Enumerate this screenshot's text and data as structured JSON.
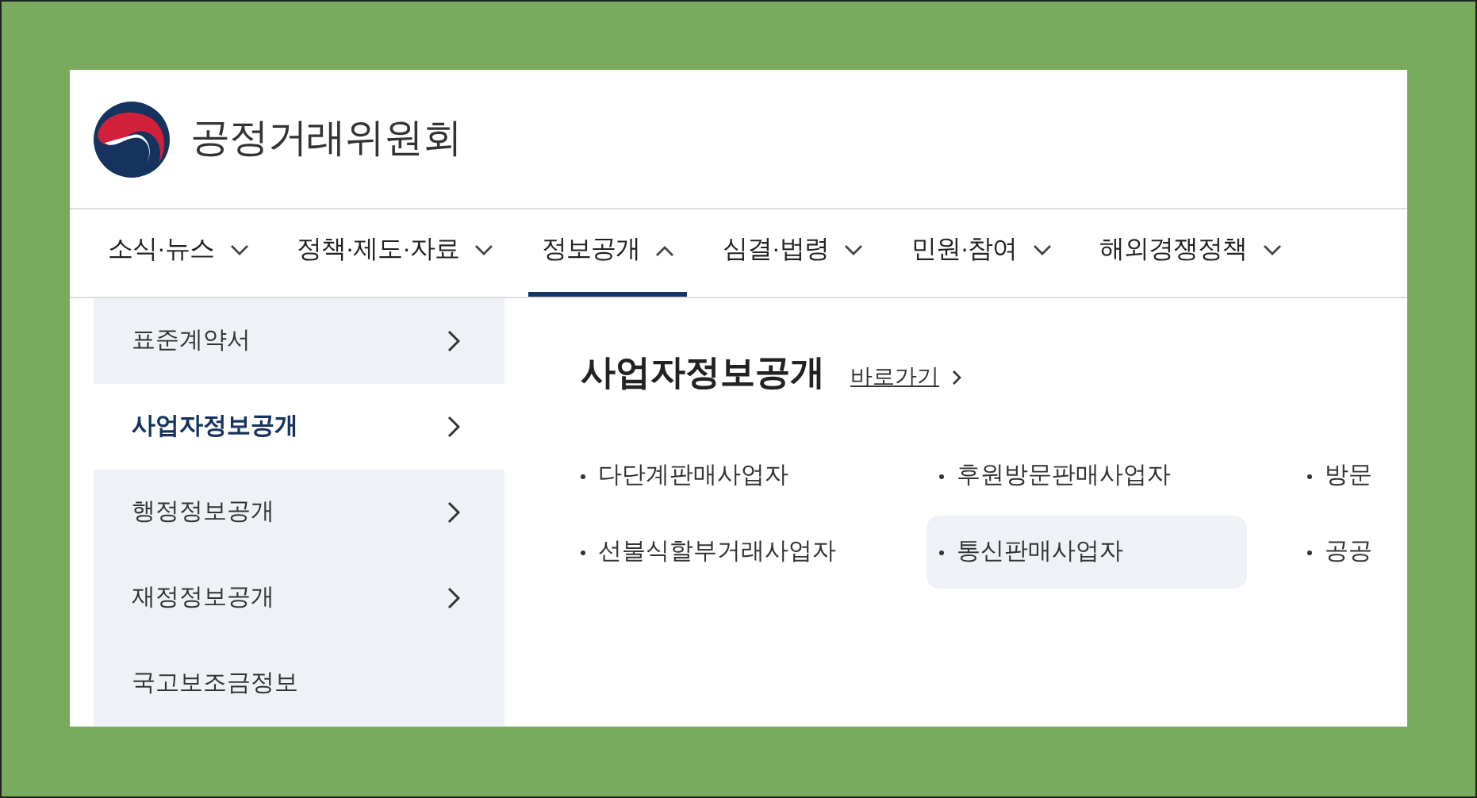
{
  "header": {
    "site_name": "공정거래위원회"
  },
  "nav": [
    {
      "label": "소식·뉴스",
      "selected": false
    },
    {
      "label": "정책·제도·자료",
      "selected": false
    },
    {
      "label": "정보공개",
      "selected": true
    },
    {
      "label": "심결·법령",
      "selected": false
    },
    {
      "label": "민원·참여",
      "selected": false
    },
    {
      "label": "해외경쟁정책",
      "selected": false
    }
  ],
  "sidebar": [
    {
      "label": "표준계약서",
      "selected": false
    },
    {
      "label": "사업자정보공개",
      "selected": true
    },
    {
      "label": "행정정보공개",
      "selected": false
    },
    {
      "label": "재정정보공개",
      "selected": false
    },
    {
      "label": "국고보조금정보",
      "selected": false
    }
  ],
  "content": {
    "title": "사업자정보공개",
    "shortcut": "바로가기",
    "links": [
      {
        "label": "다단계판매사업자",
        "hovered": false
      },
      {
        "label": "후원방문판매사업자",
        "hovered": false
      },
      {
        "label": "방문",
        "hovered": false
      },
      {
        "label": "선불식할부거래사업자",
        "hovered": false
      },
      {
        "label": "통신판매사업자",
        "hovered": true
      },
      {
        "label": "공공",
        "hovered": false
      }
    ]
  }
}
